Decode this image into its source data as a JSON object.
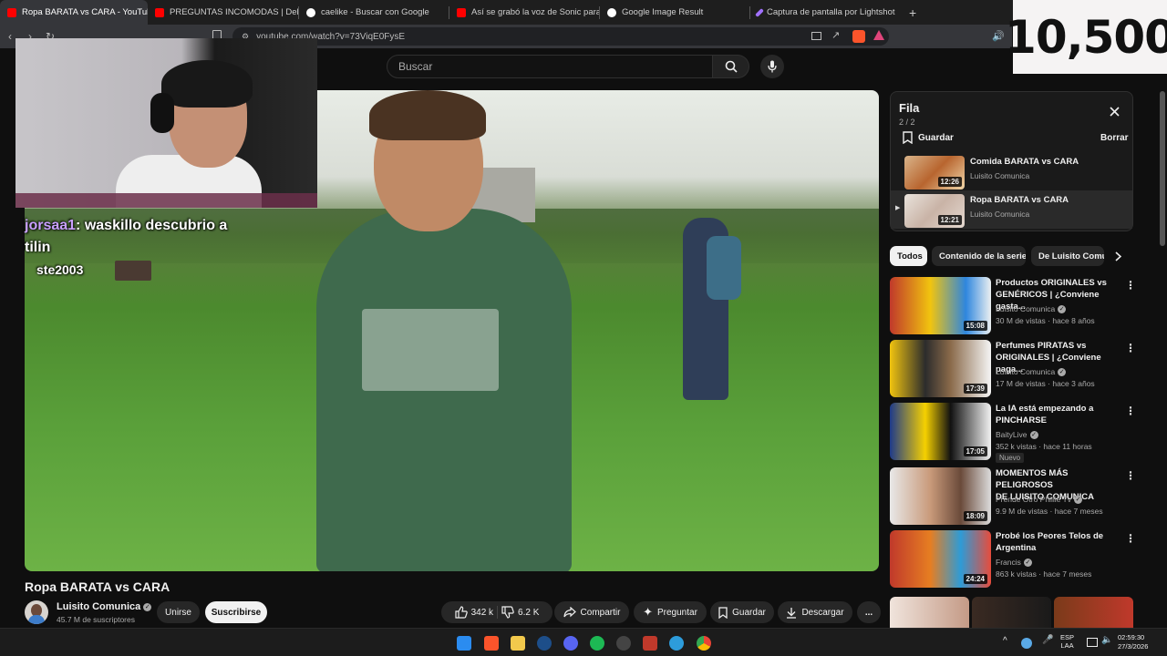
{
  "browser": {
    "tabs": [
      {
        "title": "Ropa BARATA vs CARA - YouTub",
        "icon": "youtube-icon",
        "color": "#ff0000",
        "active": true
      },
      {
        "title": "PREGUNTAS INCOMODAS | DebRyan",
        "icon": "youtube-icon",
        "color": "#ff0000",
        "active": false
      },
      {
        "title": "caelike - Buscar con Google",
        "icon": "google-icon",
        "color": "#ffffff",
        "active": false
      },
      {
        "title": "Así se grabó la voz de Sonic para Son",
        "icon": "youtube-icon",
        "color": "#ff0000",
        "active": false
      },
      {
        "title": "Google Image Result",
        "icon": "google-icon",
        "color": "#ffffff",
        "active": false
      },
      {
        "title": "Captura de pantalla por Lightshot",
        "icon": "lightshot-icon",
        "color": "#a070ff",
        "active": false
      }
    ],
    "close_tab": "×",
    "new_tab": "+",
    "url": "youtube.com/watch?v=73ViqE0FysE"
  },
  "youtube": {
    "search_placeholder": "Buscar",
    "video": {
      "title": "Ropa BARATA vs CARA",
      "channel": "Luisito Comunica",
      "subscribers": "45.7 M de suscriptores",
      "join_label": "Unirse",
      "subscribe_label": "Suscribirse",
      "likes": "342 k",
      "dislikes": "6.2 K",
      "share_label": "Compartir",
      "ask_label": "Preguntar",
      "save_label": "Guardar",
      "download_label": "Descargar",
      "more_label": "..."
    },
    "queue": {
      "title": "Fila",
      "count": "2 / 2",
      "save_label": "Guardar",
      "clear_label": "Borrar",
      "items": [
        {
          "title": "Comida BARATA vs CARA",
          "channel": "Luisito Comunica",
          "duration": "12:26",
          "playing": false
        },
        {
          "title": "Ropa BARATA vs CARA",
          "channel": "Luisito Comunica",
          "duration": "12:21",
          "playing": true,
          "indicator": "▶"
        }
      ]
    },
    "chips": [
      "Todos",
      "Contenido de la serie",
      "De Luisito Comu"
    ],
    "recommendations": [
      {
        "title_line1": "Productos ORIGINALES vs",
        "title_line2": "GENÉRICOS | ¿Conviene gasta...",
        "channel": "Luisito Comunica",
        "meta": "30 M de vistas · hace 8 años",
        "duration": "15:08",
        "badge": ""
      },
      {
        "title_line1": "Perfumes PIRATAS vs",
        "title_line2": "ORIGINALES | ¿Conviene paga...",
        "channel": "Luisito Comunica",
        "meta": "17 M de vistas · hace 3 años",
        "duration": "17:39",
        "badge": ""
      },
      {
        "title_line1": "La IA está empezando a",
        "title_line2": "PINCHARSE",
        "channel": "BaityLive",
        "meta": "352 k vistas · hace 11 horas",
        "duration": "17:05",
        "badge": "Nuevo"
      },
      {
        "title_line1": "MOMENTOS MÁS PELIGROSOS",
        "title_line2": "DE LUISITO COMUNICA",
        "channel": "Prende Otro Phillie Tv",
        "meta": "9.9 M de vistas · hace 7 meses",
        "duration": "18:09",
        "badge": ""
      },
      {
        "title_line1": "Probé los Peores Telos de",
        "title_line2": "Argentina",
        "channel": "Francis",
        "meta": "863 k vistas · hace 7 meses",
        "duration": "24:24",
        "badge": ""
      }
    ]
  },
  "stream_overlay": {
    "view_counter": "10,500",
    "chat": [
      {
        "user": "jorsaa1",
        "message": ": waskillo descubrio a"
      },
      {
        "user": "",
        "message": "tilin"
      },
      {
        "user": "ste2003",
        "message": ""
      }
    ]
  },
  "taskbar": {
    "lang_top": "ESP",
    "lang_bottom": "LAA",
    "time": "02:59:30",
    "date": "27/3/2026",
    "tray_chevron": "^"
  },
  "colors": {
    "youtube_red": "#ff0000",
    "chat_name": "#c9a0ff",
    "subscribe_bg": "#f1f1f1"
  }
}
